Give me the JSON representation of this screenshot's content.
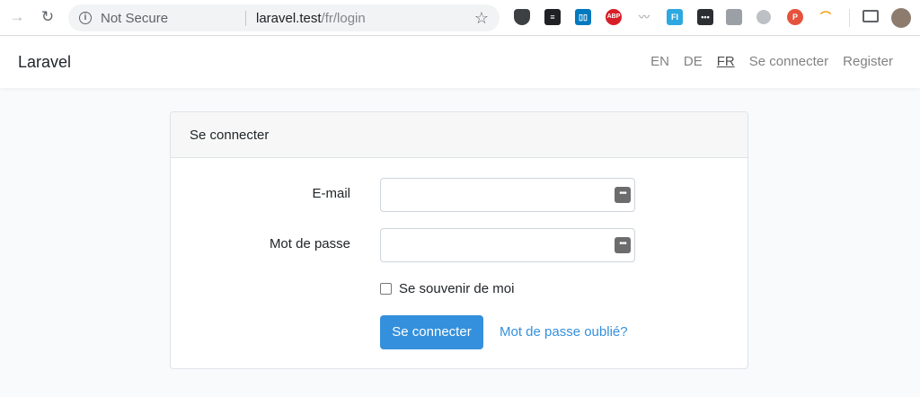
{
  "browser": {
    "back_icon": "arrow-right-icon",
    "reload_icon": "reload-icon",
    "security_label": "Not Secure",
    "url_host": "laravel.test",
    "url_path": "/fr/login",
    "extensions": {
      "abp": "ABP",
      "fi": "FI",
      "dots": "•••",
      "p": "P"
    }
  },
  "navbar": {
    "brand": "Laravel",
    "links": [
      {
        "label": "EN"
      },
      {
        "label": "DE"
      },
      {
        "label": "FR",
        "active": true
      },
      {
        "label": "Se connecter"
      },
      {
        "label": "Register"
      }
    ]
  },
  "card": {
    "header": "Se connecter",
    "email_label": "E-mail",
    "email_value": "",
    "password_label": "Mot de passe",
    "password_value": "",
    "remember_label": "Se souvenir de moi",
    "submit_label": "Se connecter",
    "forgot_label": "Mot de passe oublié?",
    "key_icon_glyph": "•••"
  },
  "colors": {
    "primary": "#3490dc",
    "page_bg": "#f8fafc"
  }
}
